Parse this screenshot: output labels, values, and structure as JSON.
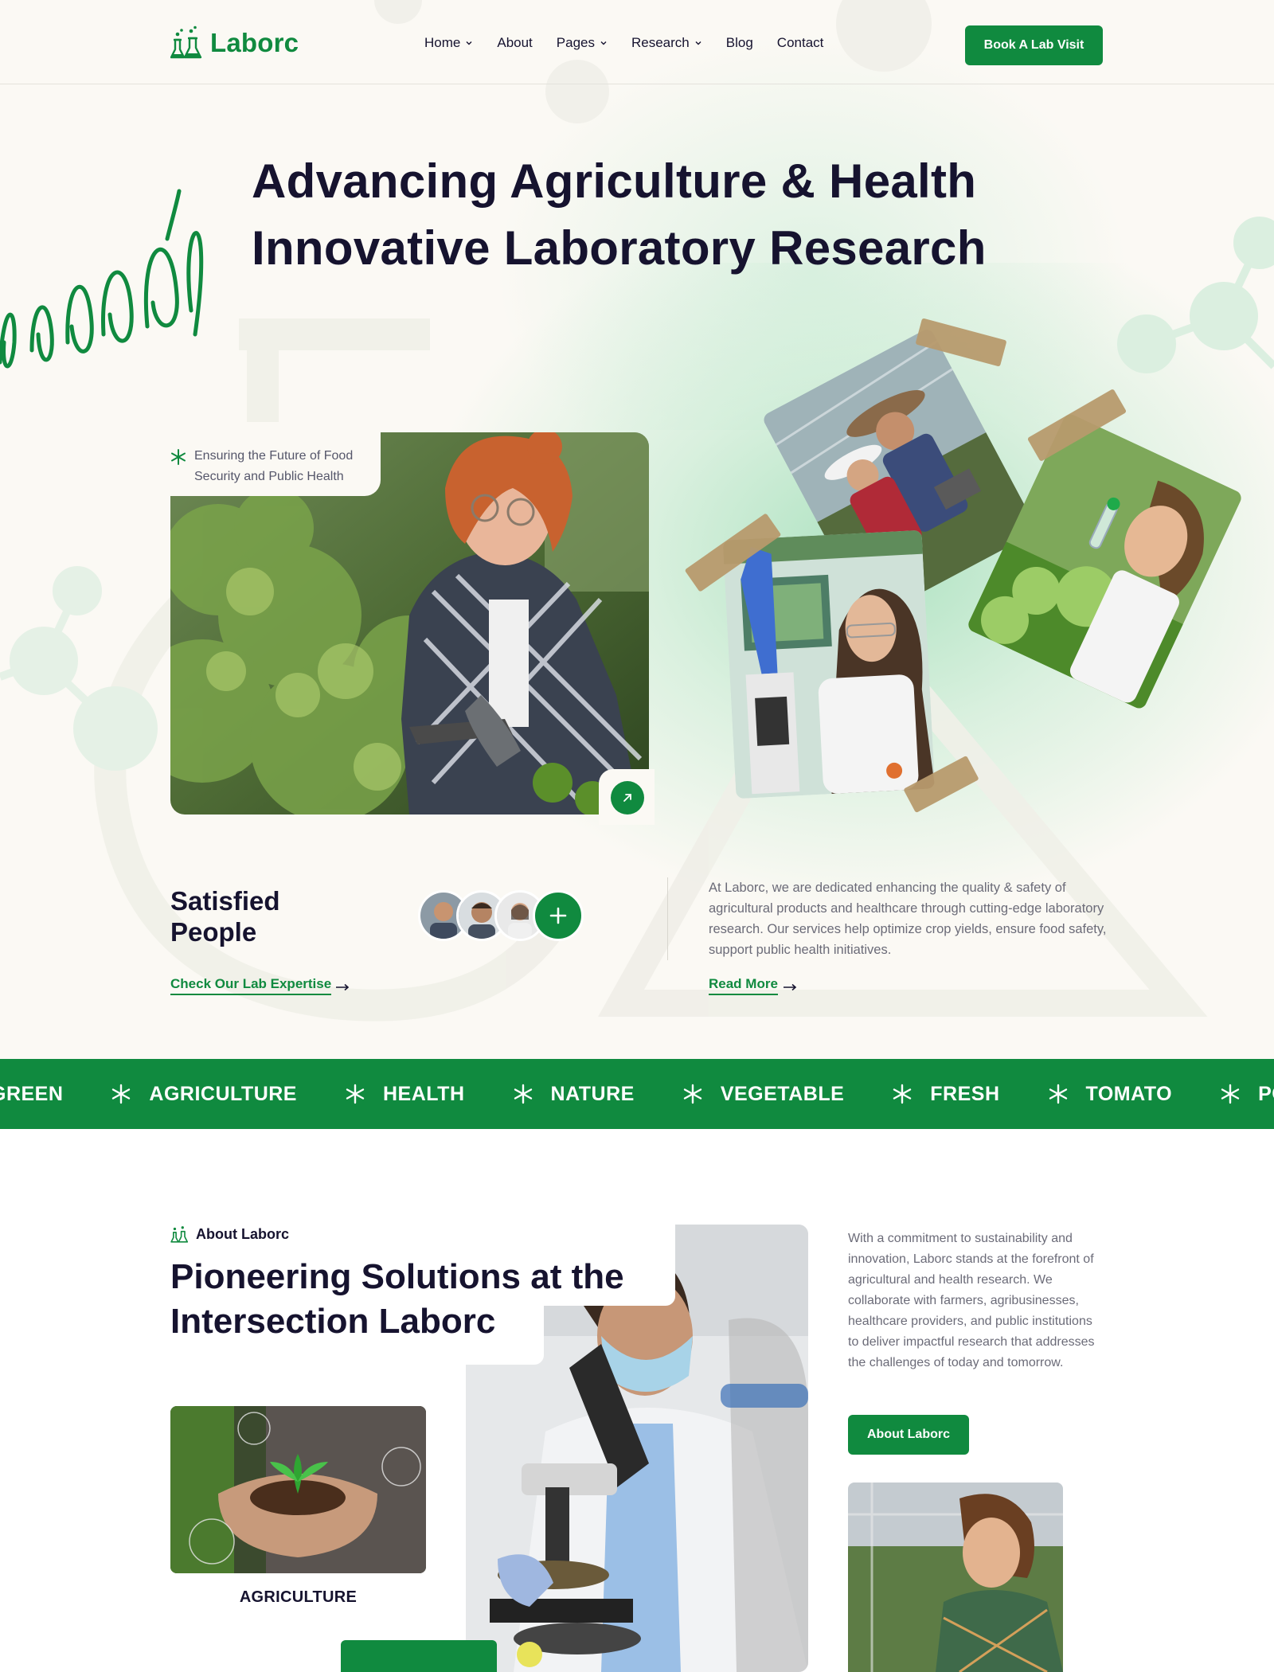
{
  "header": {
    "brand": "Laborc",
    "nav": [
      {
        "label": "Home",
        "has_dropdown": true
      },
      {
        "label": "About",
        "has_dropdown": false
      },
      {
        "label": "Pages",
        "has_dropdown": true
      },
      {
        "label": "Research",
        "has_dropdown": true
      },
      {
        "label": "Blog",
        "has_dropdown": false
      },
      {
        "label": "Contact",
        "has_dropdown": false
      }
    ],
    "cta": "Book A Lab Visit"
  },
  "hero": {
    "title_line1": "Advancing Agriculture & Health",
    "title_line2": "Innovative Laboratory Research",
    "tagline": "Ensuring the Future of Food Security and Public Health",
    "satisfied_title": "Satisfied People",
    "check_link": "Check Our Lab Expertise",
    "about_text": "At Laborc, we are dedicated enhancing the quality & safety of agricultural products and healthcare through cutting-edge laboratory research. Our services help optimize crop yields, ensure food safety,  support public health initiatives.",
    "read_more": "Read More"
  },
  "ticker": {
    "items": [
      "GREEN",
      "AGRICULTURE",
      "HEALTH",
      "NATURE",
      "VEGETABLE",
      "FRESH",
      "TOMATO",
      "PO"
    ]
  },
  "about": {
    "label": "About Laborc",
    "title_line1": "Pioneering Solutions at the",
    "title_line2": "Intersection Laborc",
    "card_caption": "AGRICULTURE",
    "paragraph": "With a commitment to sustainability and innovation, Laborc stands at the forefront of agricultural and health research. We collaborate with farmers, agribusinesses, healthcare providers, and public institutions to deliver impactful research that addresses the challenges of today and tomorrow.",
    "button": "About Laborc"
  },
  "colors": {
    "brand_green": "#108a3f",
    "heading": "#16132f",
    "background": "#fbf9f4"
  },
  "icons": {
    "logo": "lab-flask-icon",
    "tag": "asterisk-leaf-icon",
    "arrow": "arrow-up-right-icon",
    "plus": "plus-icon"
  }
}
